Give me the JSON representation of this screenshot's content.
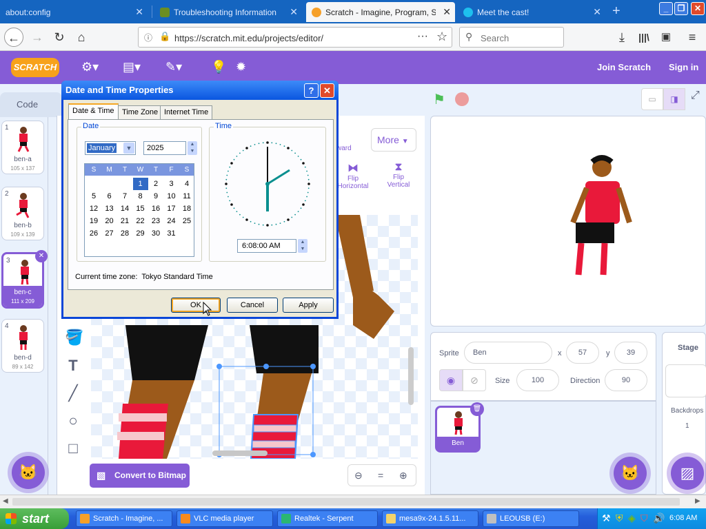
{
  "browser": {
    "tabs": [
      {
        "title": "about:config"
      },
      {
        "title": "Troubleshooting Information"
      },
      {
        "title": "Scratch - Imagine, Program, Share"
      },
      {
        "title": "Meet the cast!"
      }
    ],
    "url": "https://scratch.mit.edu/projects/editor/",
    "search_placeholder": "Search"
  },
  "scratch": {
    "logo": "SCRATCH",
    "join": "Join Scratch",
    "signin": "Sign in",
    "code_tab": "Code",
    "more_label": "More",
    "forward_label": "ward",
    "flip_h": [
      "Flip",
      "Horizontal"
    ],
    "flip_v": [
      "Flip",
      "Vertical"
    ],
    "convert_bitmap": "Convert to Bitmap",
    "costumes": [
      {
        "num": "1",
        "name": "ben-a",
        "size": "105 x 137"
      },
      {
        "num": "2",
        "name": "ben-b",
        "size": "109 x 139"
      },
      {
        "num": "3",
        "name": "ben-c",
        "size": "111 x 209"
      },
      {
        "num": "4",
        "name": "ben-d",
        "size": "89 x 142"
      }
    ],
    "sprite": {
      "label": "Sprite",
      "name": "Ben",
      "x_label": "x",
      "x": "57",
      "y_label": "y",
      "y": "39",
      "size_label": "Size",
      "size": "100",
      "direction_label": "Direction",
      "direction": "90",
      "thumb_name": "Ben"
    },
    "stage": {
      "label": "Stage",
      "backdrops_label": "Backdrops",
      "backdrops_count": "1"
    }
  },
  "dialog": {
    "title": "Date and Time Properties",
    "tabs": [
      "Date & Time",
      "Time Zone",
      "Internet Time"
    ],
    "date_label": "Date",
    "month": "January",
    "year": "2025",
    "weekdays": [
      "S",
      "M",
      "T",
      "W",
      "T",
      "F",
      "S"
    ],
    "days": [
      "1",
      "2",
      "3",
      "4",
      "5",
      "6",
      "7",
      "8",
      "9",
      "10",
      "11",
      "12",
      "13",
      "14",
      "15",
      "16",
      "17",
      "18",
      "19",
      "20",
      "21",
      "22",
      "23",
      "24",
      "25",
      "26",
      "27",
      "28",
      "29",
      "30",
      "31"
    ],
    "selected_day": "1",
    "time_label": "Time",
    "time_value": "6:08:00 AM",
    "timezone_text": "Current time zone:  Tokyo Standard Time",
    "ok": "OK",
    "cancel": "Cancel",
    "apply": "Apply"
  },
  "taskbar": {
    "start": "start",
    "tasks": [
      "Scratch - Imagine, ...",
      "VLC media player",
      "Realtek - Serpent",
      "mesa9x-24.1.5.11...",
      "LEOUSB (E:)"
    ],
    "clock": "6:08 AM"
  },
  "colors": {
    "scratch_purple": "#855cd6",
    "firefox_blue": "#1565c0",
    "xp_blue": "#0a46d8"
  }
}
